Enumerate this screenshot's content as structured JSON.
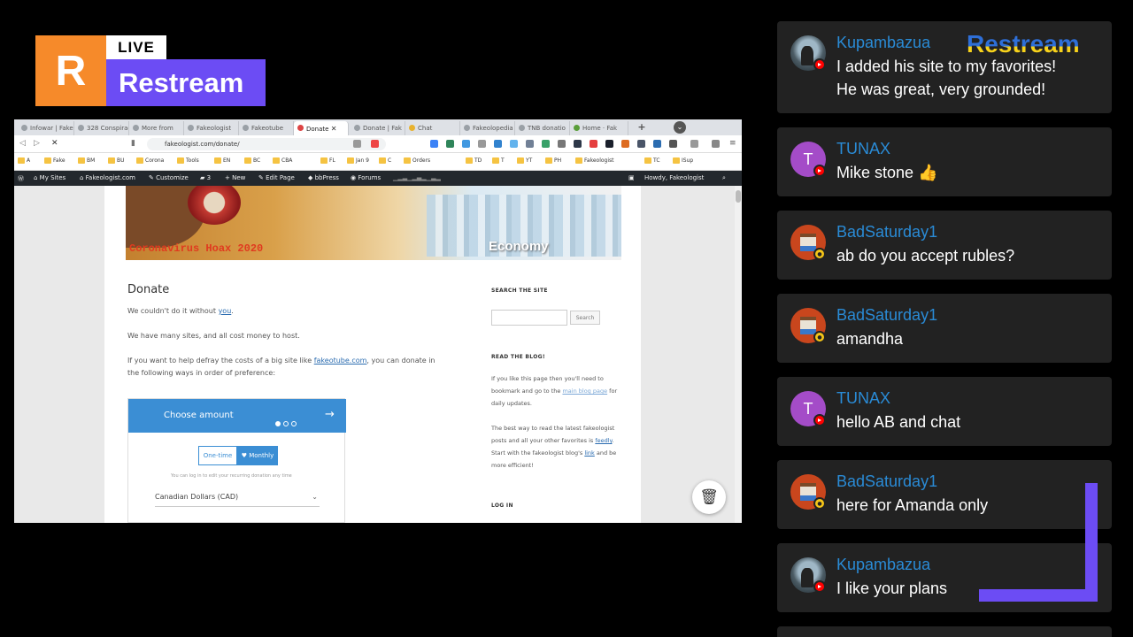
{
  "overlay": {
    "logo_letter": "R",
    "live_label": "LIVE",
    "brand": "Restream",
    "watermark": "Restream",
    "accent": "#6c4cf4",
    "logo_color": "#f68a2a"
  },
  "browser": {
    "tabs": [
      "Infowar | Fakeo",
      "328 Conspiracy",
      "More from",
      "Fakeologist",
      "Fakeotube",
      "Donate",
      "Donate | Fak",
      "Chat",
      "Fakeolopedia",
      "TNB donatio",
      "Home · Fak"
    ],
    "active_tab_index": 5,
    "url": "fakeologist.com/donate/",
    "bookmarks": [
      "A",
      "Fake",
      "BM",
      "BU",
      "Corona",
      "Tools",
      "EN",
      "BC",
      "CBA",
      "FL",
      "Jan 9",
      "C",
      "Orders",
      "TD",
      "T",
      "YT",
      "PH",
      "Fakeologist",
      "TC",
      "ISup"
    ],
    "wp_admin": {
      "my_sites": "My Sites",
      "site": "Fakeologist.com",
      "customize": "Customize",
      "comments": "3",
      "new": "New",
      "edit_page": "Edit Page",
      "bbpress": "bbPress",
      "forums": "Forums",
      "howdy": "Howdy, Fakeologist"
    },
    "page": {
      "banner_left": "Coronavirus Hoax 2020",
      "banner_right": "Economy",
      "title": "Donate",
      "p1_text": "We couldn't do it without ",
      "p1_link": "you",
      "p1_end": ".",
      "p2": "We have many sites, and all cost money to host.",
      "p3_text": "If you want to help defray the costs of a big site like ",
      "p3_link": "fakeotube.com",
      "p3_end": ", you can donate in the following ways in order of preference:",
      "widget": {
        "title": "Choose amount",
        "one_time": "One-time",
        "monthly": "♥ Monthly",
        "note": "You can log in to edit your recurring donation any time",
        "currency": "Canadian Dollars (CAD)"
      },
      "sidebar": {
        "search_heading": "SEARCH THE SITE",
        "search_button": "Search",
        "blog_heading": "READ THE BLOG!",
        "blog_p1_a": "If you like this page then you'll need to bookmark and go to the ",
        "blog_p1_link": "main blog page",
        "blog_p1_b": " for daily updates.",
        "blog_p2_a": "The best way to read the latest fakeologist posts and all your other favorites is ",
        "blog_p2_link1": "feedly",
        "blog_p2_b": ". Start with the fakeologist blog's ",
        "blog_p2_link2": "link",
        "blog_p2_c": " and be more efficient!",
        "login_heading": "LOG IN"
      }
    }
  },
  "chat": {
    "messages": [
      {
        "name": "Kupambazua",
        "lines": [
          "I added his site to my favorites!",
          "He was great, very grounded!"
        ],
        "platform": "youtube",
        "avatar": "photo"
      },
      {
        "name": "TUNAX",
        "lines": [
          "Mike stone 👍"
        ],
        "platform": "youtube",
        "avatar": "T"
      },
      {
        "name": "BadSaturday1",
        "lines": [
          "ab do you accept rubles?"
        ],
        "platform": "game",
        "avatar": "pixel"
      },
      {
        "name": "BadSaturday1",
        "lines": [
          "amandha"
        ],
        "platform": "game",
        "avatar": "pixel"
      },
      {
        "name": "TUNAX",
        "lines": [
          "hello AB and chat"
        ],
        "platform": "youtube",
        "avatar": "T"
      },
      {
        "name": "BadSaturday1",
        "lines": [
          "here for Amanda only"
        ],
        "platform": "game",
        "avatar": "pixel"
      },
      {
        "name": "Kupambazua",
        "lines": [
          "I like your plans"
        ],
        "platform": "youtube",
        "avatar": "photo"
      }
    ]
  }
}
